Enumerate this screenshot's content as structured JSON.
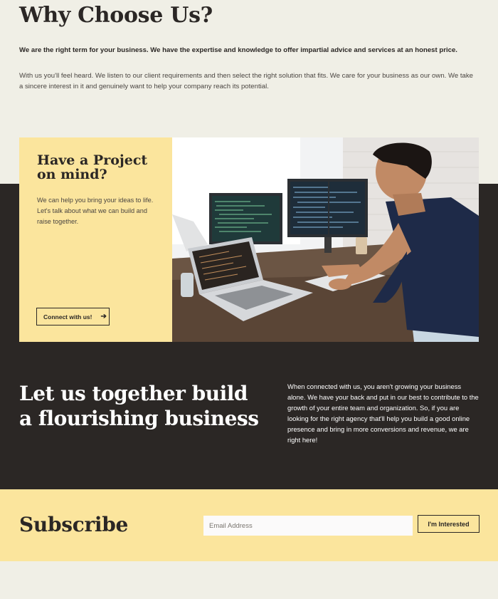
{
  "why": {
    "title": "Why Choose Us?",
    "lead": "We are the right term for your business. We have the expertise and knowledge to offer impartial advice and services at an honest price.",
    "body": "With us you'll feel heard. We listen to our client requirements and then select the right solution that fits. We care for your business as our own. We take a sincere interest in it and genuinely want to help your company reach its potential."
  },
  "project": {
    "title": "Have a Project on mind?",
    "text": "We can help you bring your ideas to life. Let's talk about what we can build and raise together.",
    "button_label": "Connect with us!",
    "button_icon": "arrow-right-icon"
  },
  "together": {
    "title": "Let us together build a flourishing business",
    "text": "When connected with us, you aren't growing your business alone. We have your back and put in our best to contribute to the growth of your entire team and organization. So, if you are looking for the right agency that'll help you build a good online presence and bring in more conversions and revenue, we are right here!"
  },
  "subscribe": {
    "title": "Subscribe",
    "email_placeholder": "Email Address",
    "button_label": "I'm Interested"
  },
  "colors": {
    "background": "#f0efe6",
    "dark": "#2b2725",
    "accent_yellow": "#fbe59d"
  }
}
